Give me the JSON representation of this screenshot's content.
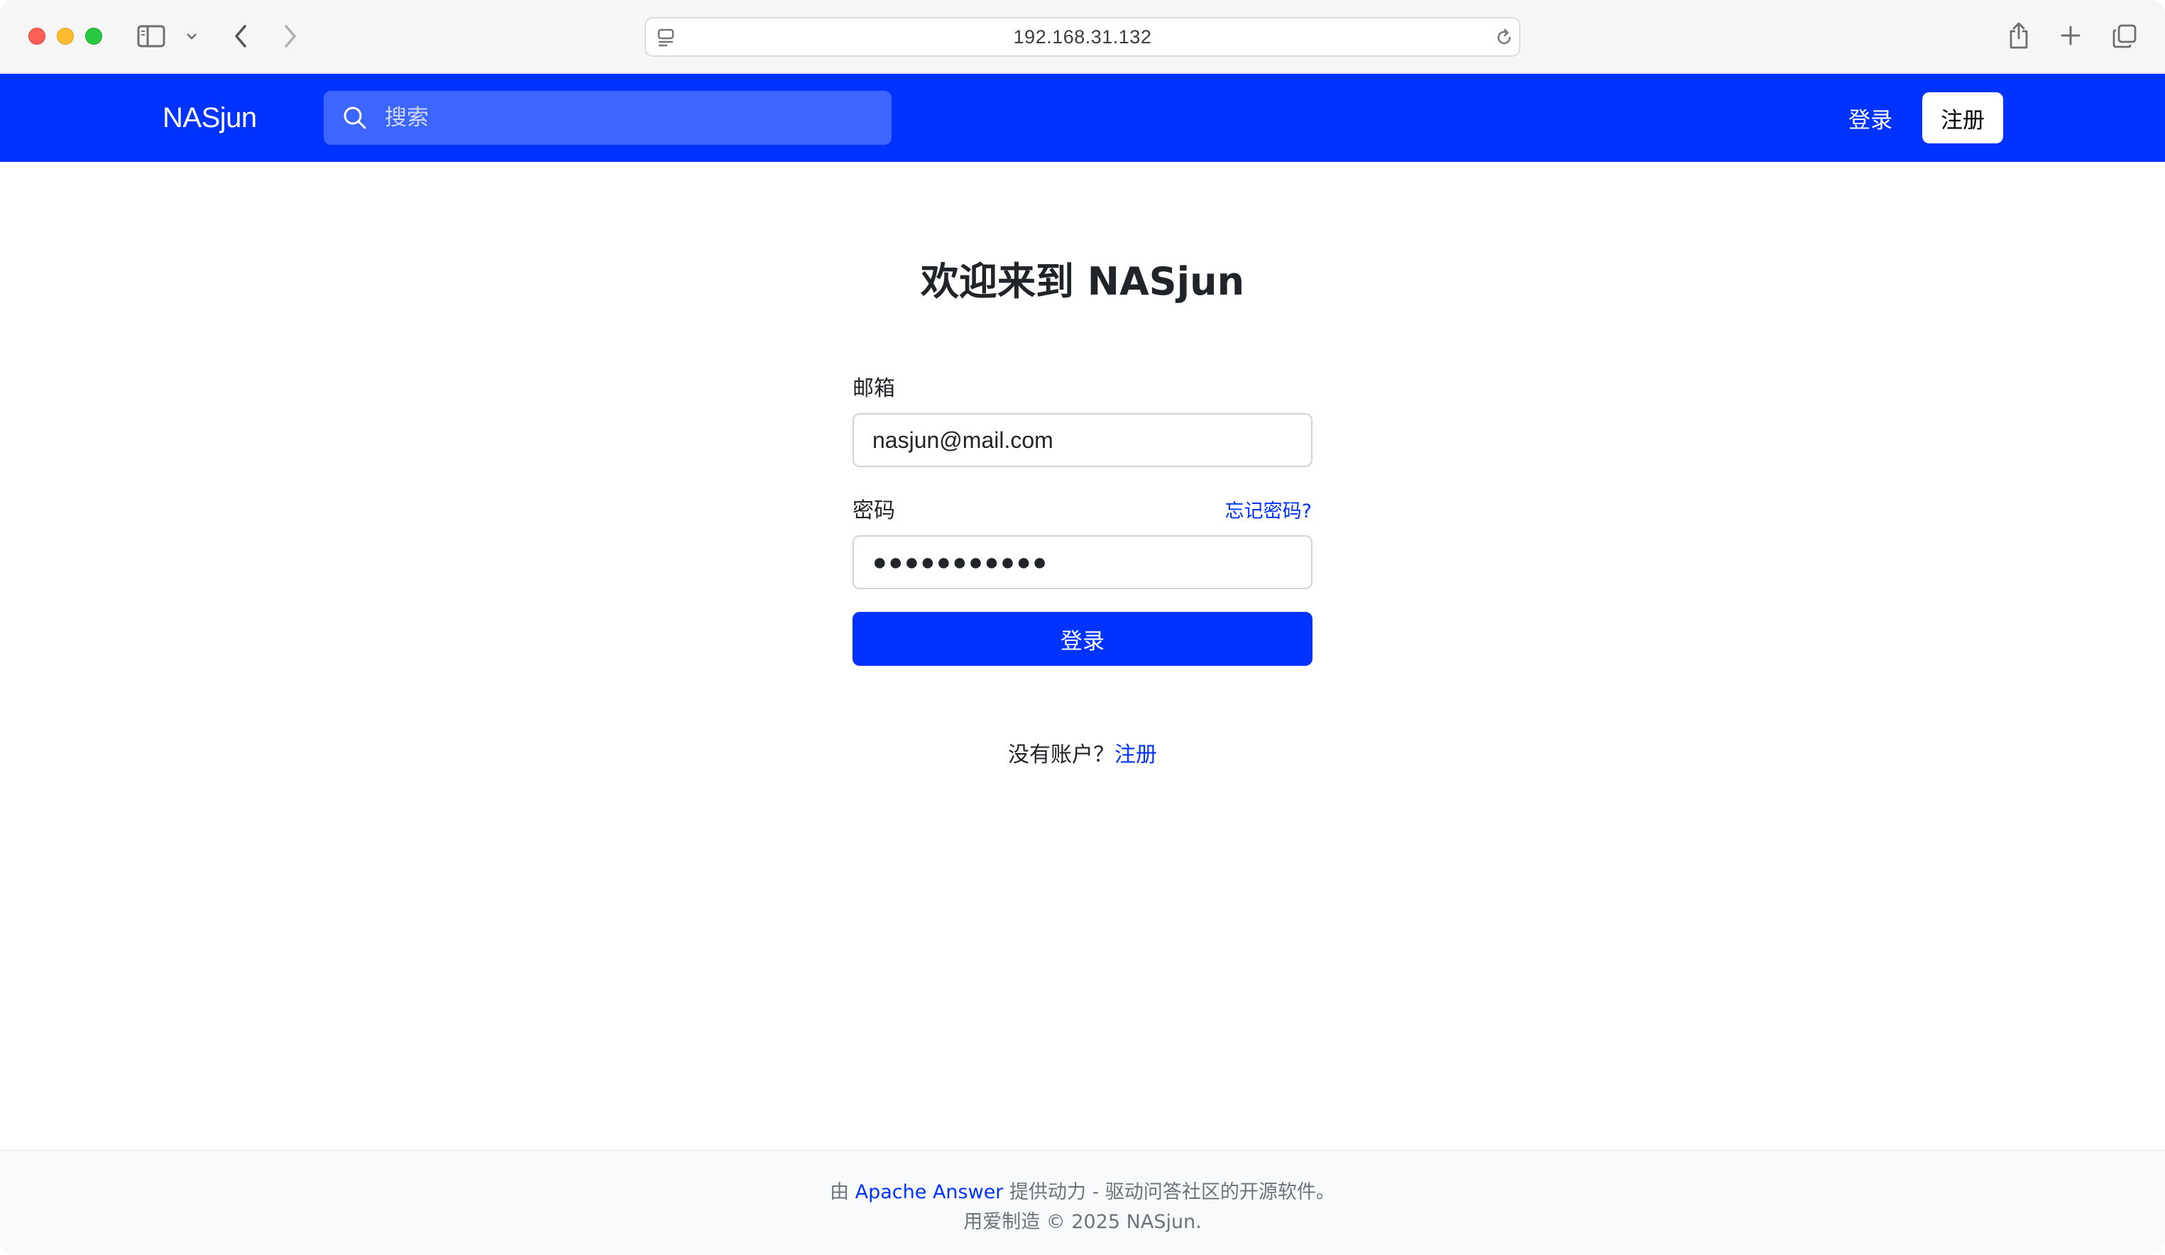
{
  "browser": {
    "url": "192.168.31.132"
  },
  "navbar": {
    "brand": "NASjun",
    "search_placeholder": "搜索",
    "login_label": "登录",
    "signup_label": "注册"
  },
  "login_form": {
    "title": "欢迎来到 NASjun",
    "email_label": "邮箱",
    "email_value": "nasjun@mail.com",
    "password_label": "密码",
    "forgot_password": "忘记密码?",
    "password_value": "●●●●●●●●●●●",
    "submit_label": "登录",
    "no_account_text": "没有账户？",
    "signup_link": "注册"
  },
  "footer": {
    "powered_prefix": "由",
    "powered_link": "Apache Answer",
    "powered_suffix": "提供动力 - 驱动问答社区的开源软件。",
    "made_with": "用爱制造 © 2025 NASjun."
  },
  "colors": {
    "brand_blue": "#0033ff",
    "search_bg": "#3d66ff",
    "footer_bg": "#f8f9fa"
  }
}
